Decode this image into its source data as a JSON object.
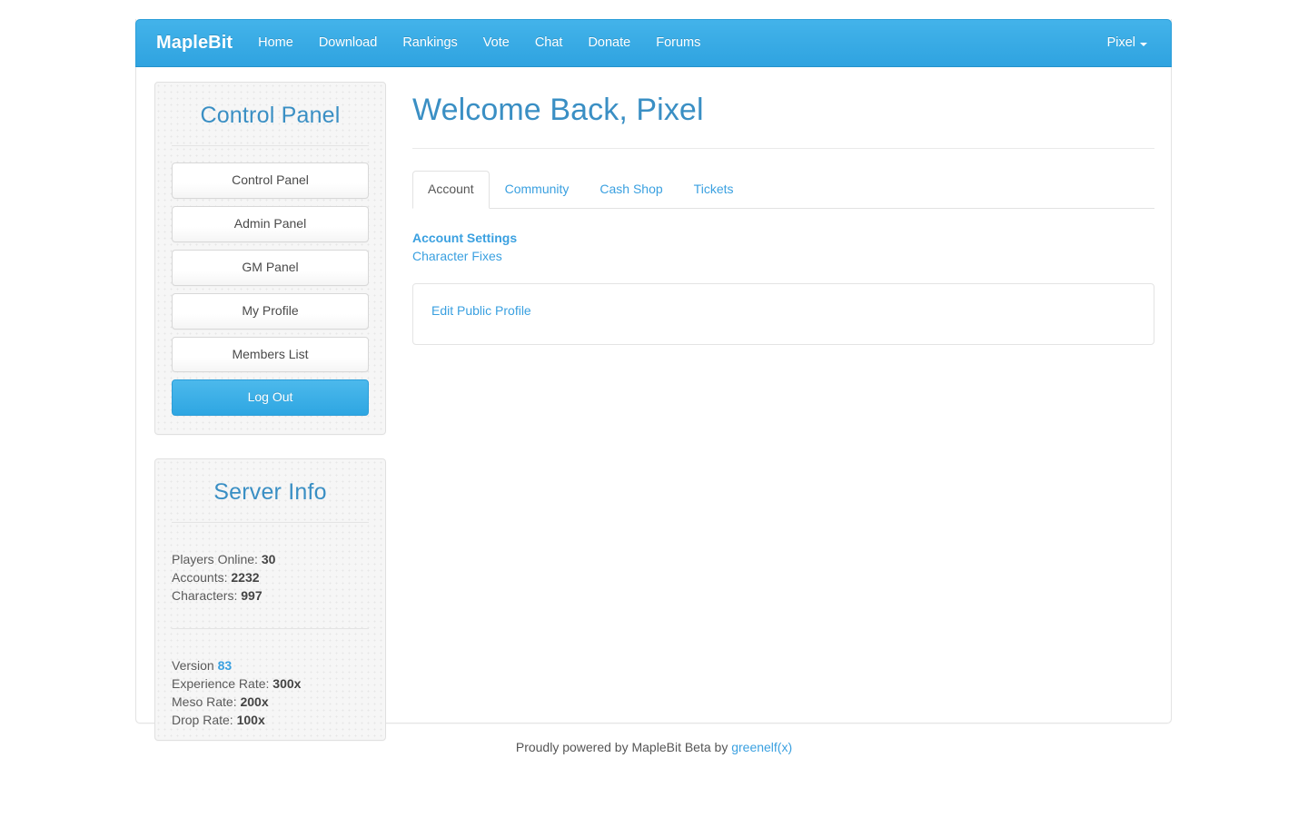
{
  "navbar": {
    "brand": "MapleBit",
    "links": [
      {
        "label": "Home"
      },
      {
        "label": "Download"
      },
      {
        "label": "Rankings"
      },
      {
        "label": "Vote"
      },
      {
        "label": "Chat"
      },
      {
        "label": "Donate"
      },
      {
        "label": "Forums"
      }
    ],
    "user": "Pixel",
    "user_caret_icon": "caret-down-icon",
    "accent_color": "#37a8e4"
  },
  "sidebar": {
    "control_panel": {
      "heading": "Control Panel",
      "buttons": [
        {
          "label": "Control Panel",
          "style": "default"
        },
        {
          "label": "Admin Panel",
          "style": "default"
        },
        {
          "label": "GM Panel",
          "style": "default"
        },
        {
          "label": "My Profile",
          "style": "default"
        },
        {
          "label": "Members List",
          "style": "default"
        },
        {
          "label": "Log Out",
          "style": "primary"
        }
      ]
    },
    "server_info": {
      "heading": "Server Info",
      "stats": [
        {
          "label": "Players Online:",
          "value": "30"
        },
        {
          "label": "Accounts:",
          "value": "2232"
        },
        {
          "label": "Characters:",
          "value": "997"
        }
      ],
      "rates": [
        {
          "label": "Version",
          "value": "83",
          "link": true
        },
        {
          "label": "Experience Rate:",
          "value": "300x"
        },
        {
          "label": "Meso Rate:",
          "value": "200x"
        },
        {
          "label": "Drop Rate:",
          "value": "100x"
        }
      ]
    }
  },
  "main": {
    "title": "Welcome Back, Pixel",
    "tabs": [
      {
        "label": "Account",
        "active": true
      },
      {
        "label": "Community",
        "active": false
      },
      {
        "label": "Cash Shop",
        "active": false
      },
      {
        "label": "Tickets",
        "active": false
      }
    ],
    "settings_links": [
      {
        "label": "Account Settings",
        "strong": true
      },
      {
        "label": "Character Fixes",
        "strong": false
      }
    ],
    "well": {
      "link_label": "Edit Public Profile"
    }
  },
  "footer": {
    "text": "Proudly powered by MapleBit Beta by",
    "link": "greenelf(x)"
  }
}
